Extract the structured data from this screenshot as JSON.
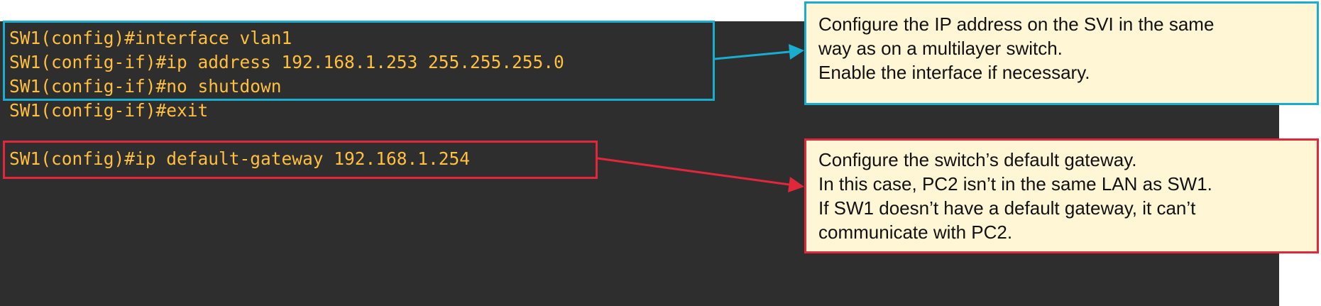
{
  "terminal": {
    "lines": [
      "SW1(config)#interface vlan1",
      "SW1(config-if)#ip address 192.168.1.253 255.255.255.0",
      "SW1(config-if)#no shutdown",
      "SW1(config-if)#exit",
      "SW1(config)#ip default-gateway 192.168.1.254"
    ]
  },
  "callouts": {
    "svi": {
      "lines": [
        "Configure the IP address on the SVI in the same",
        "way as on a multilayer switch.",
        "Enable the interface if necessary."
      ]
    },
    "gateway": {
      "lines": [
        "Configure the switch’s default gateway.",
        "In this case, PC2 isn’t in the same LAN as SW1.",
        "If SW1 doesn’t have a default gateway, it can’t",
        "communicate with PC2."
      ]
    }
  },
  "colors": {
    "terminal_background": "#2e2e2e",
    "cli_text": "#ffbf3f",
    "highlight_cyan": "#19aed0",
    "highlight_red": "#e0273b",
    "callout_background": "#fff6d6"
  }
}
